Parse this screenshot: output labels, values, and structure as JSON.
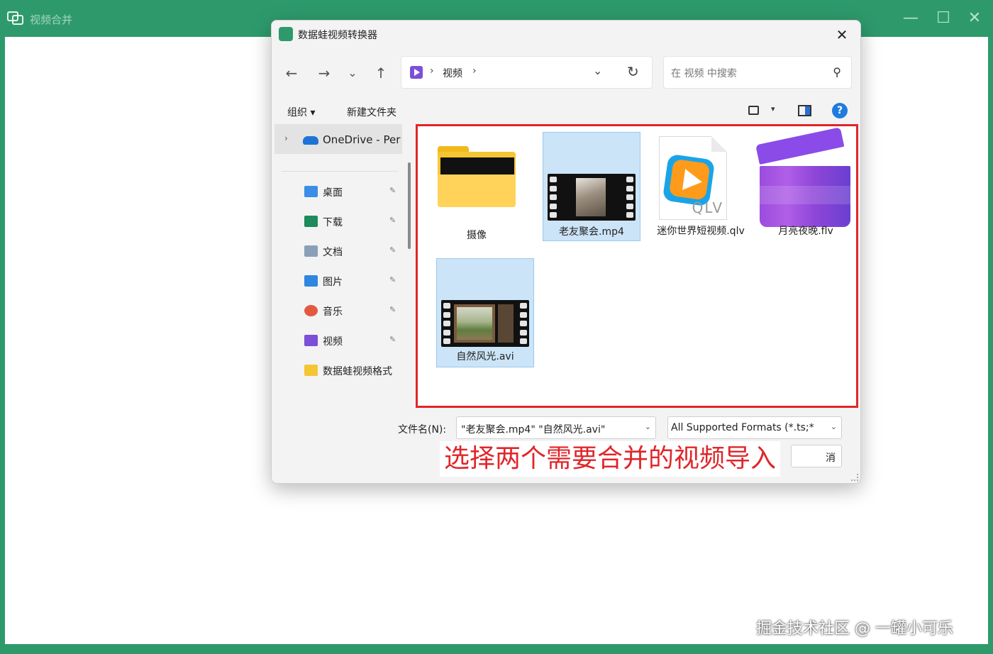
{
  "app": {
    "title": "视频合并",
    "min_glyph": "—",
    "max_glyph": "☐",
    "close_glyph": "✕"
  },
  "dialog": {
    "title": "数据蛙视频转换器",
    "close_glyph": "✕",
    "nav": {
      "back": "←",
      "forward": "→",
      "recent": "⌄",
      "up": "↑"
    },
    "address": {
      "sep": "›",
      "crumb": "视频",
      "drop": "⌄",
      "refresh": "↻"
    },
    "search": {
      "placeholder": "在 视频 中搜索",
      "icon_glyph": "⚲"
    },
    "toolbar": {
      "organize": "组织 ▾",
      "new_folder": "新建文件夹",
      "view_drop": "▾",
      "help": "?"
    },
    "sidebar": {
      "onedrive": "OneDrive - Per",
      "chevron": "›",
      "pin_glyph": "✎",
      "items": [
        {
          "label": "桌面",
          "icon": "desktop-icon",
          "color": "#3a8ee6",
          "pinned": true
        },
        {
          "label": "下载",
          "icon": "download-icon",
          "color": "#1f8a5b",
          "pinned": true
        },
        {
          "label": "文档",
          "icon": "document-icon",
          "color": "#8aa0b8",
          "pinned": true
        },
        {
          "label": "图片",
          "icon": "pictures-icon",
          "color": "#2e86e0",
          "pinned": true
        },
        {
          "label": "音乐",
          "icon": "music-icon",
          "color": "#e2593f",
          "pinned": true
        },
        {
          "label": "视频",
          "icon": "videos-icon",
          "color": "#7b4fd6",
          "pinned": true
        },
        {
          "label": "数据蛙视频格式",
          "icon": "folder-icon",
          "color": "#f5c634",
          "pinned": false
        }
      ]
    },
    "files": [
      {
        "name": "摄像",
        "kind": "folder",
        "selected": false
      },
      {
        "name": "老友聚会.mp4",
        "kind": "video",
        "selected": true
      },
      {
        "name": "迷你世界短视频.qlv",
        "kind": "qlv",
        "selected": false
      },
      {
        "name": "月亮夜晚.flv",
        "kind": "flv",
        "selected": false
      },
      {
        "name": "自然风光.avi",
        "kind": "video",
        "selected": true
      }
    ],
    "qlv_badge": "QLV",
    "footer": {
      "filename_label": "文件名(N):",
      "filename_value": "\"老友聚会.mp4\" \"自然风光.avi\"",
      "filter_value": "All Supported Formats (*.ts;*",
      "cancel_label": "消",
      "drop": "⌄"
    }
  },
  "annotation": "选择两个需要合并的视频导入",
  "watermark": "掘金技术社区 @ 一罐小可乐"
}
